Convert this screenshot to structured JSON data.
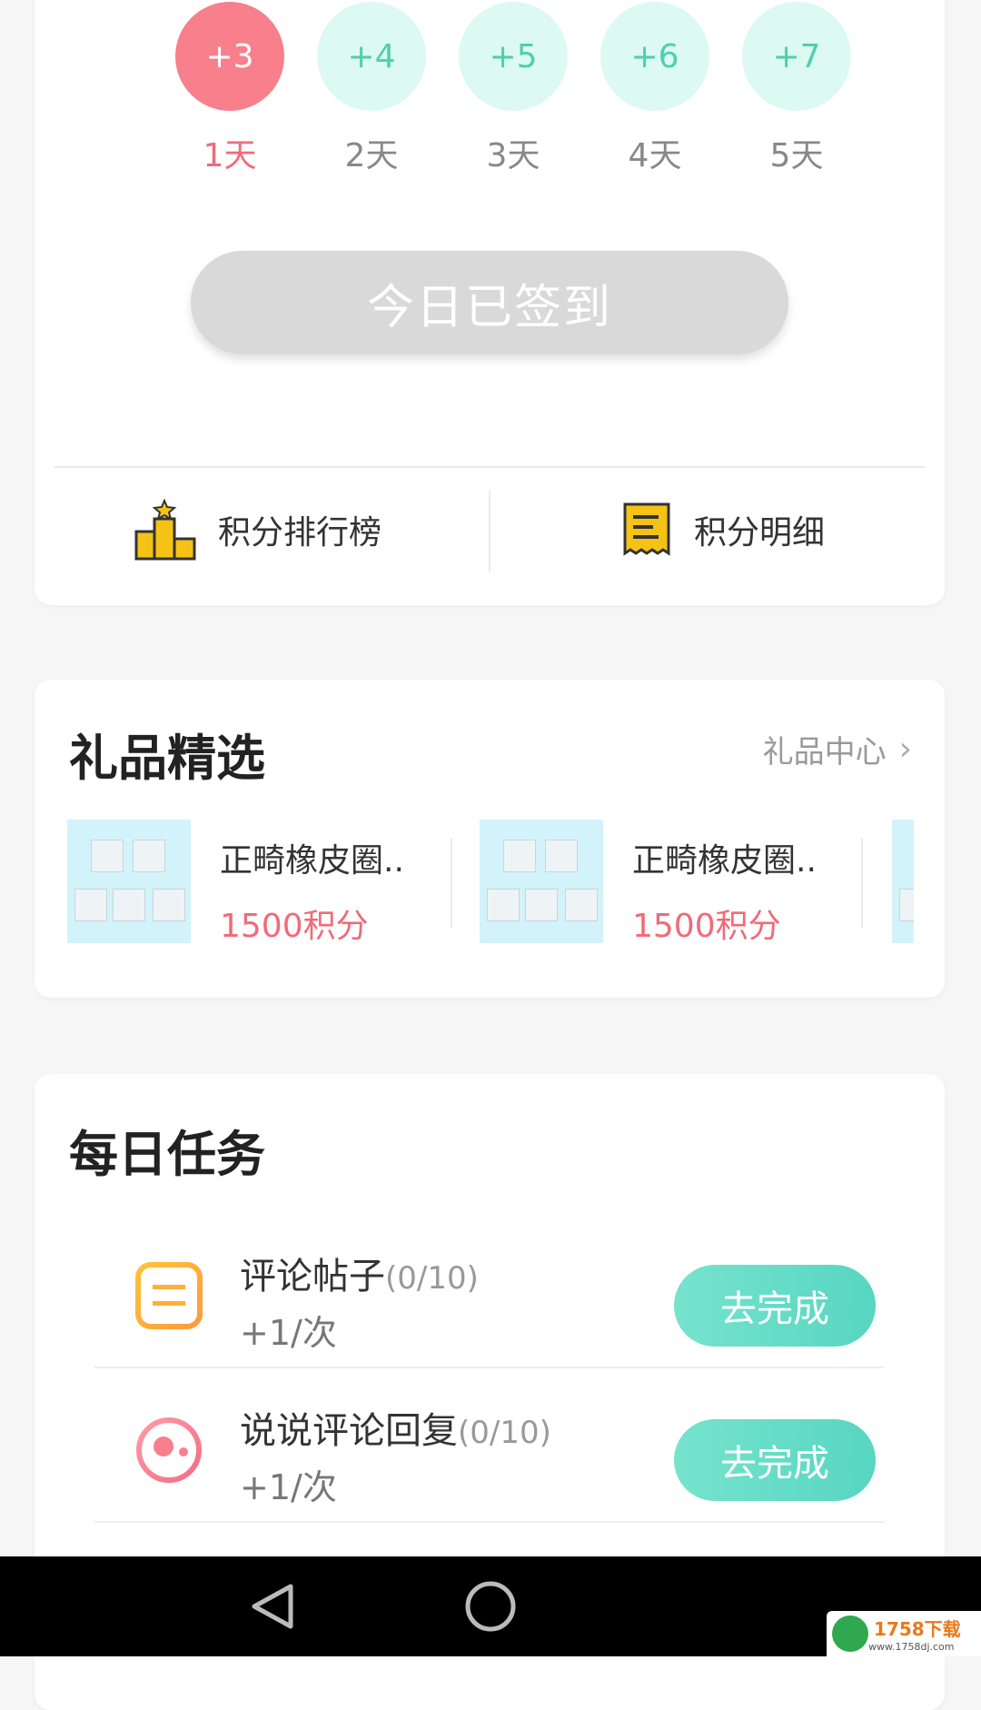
{
  "checkin": {
    "days": [
      {
        "points": "+3",
        "label": "1天",
        "active": true
      },
      {
        "points": "+4",
        "label": "2天",
        "active": false
      },
      {
        "points": "+5",
        "label": "3天",
        "active": false
      },
      {
        "points": "+6",
        "label": "4天",
        "active": false
      },
      {
        "points": "+7",
        "label": "5天",
        "active": false
      }
    ],
    "signed_label": "今日已签到",
    "ranking_label": "积分排行榜",
    "details_label": "积分明细"
  },
  "gifts": {
    "title": "礼品精选",
    "center_label": "礼品中心",
    "items": [
      {
        "name": "正畸橡皮圈..",
        "points": "1500积分"
      },
      {
        "name": "正畸橡皮圈..",
        "points": "1500积分"
      }
    ]
  },
  "tasks": {
    "title": "每日任务",
    "items": [
      {
        "title": "评论帖子",
        "progress_open": "(",
        "progress_current": "0",
        "progress_total": "/10)",
        "reward": "+1/次",
        "button": "去完成",
        "icon": "note-icon"
      },
      {
        "title": "说说评论回复",
        "progress_open": "(",
        "progress_current": "0",
        "progress_total": "/10)",
        "reward": "+1/次",
        "button": "去完成",
        "icon": "bubble-icon"
      }
    ]
  },
  "watermark": {
    "brand": "1758下载",
    "url": "www.1758dj.com"
  },
  "colors": {
    "accent_pink": "#f06b79",
    "accent_green": "#57d6c2"
  }
}
